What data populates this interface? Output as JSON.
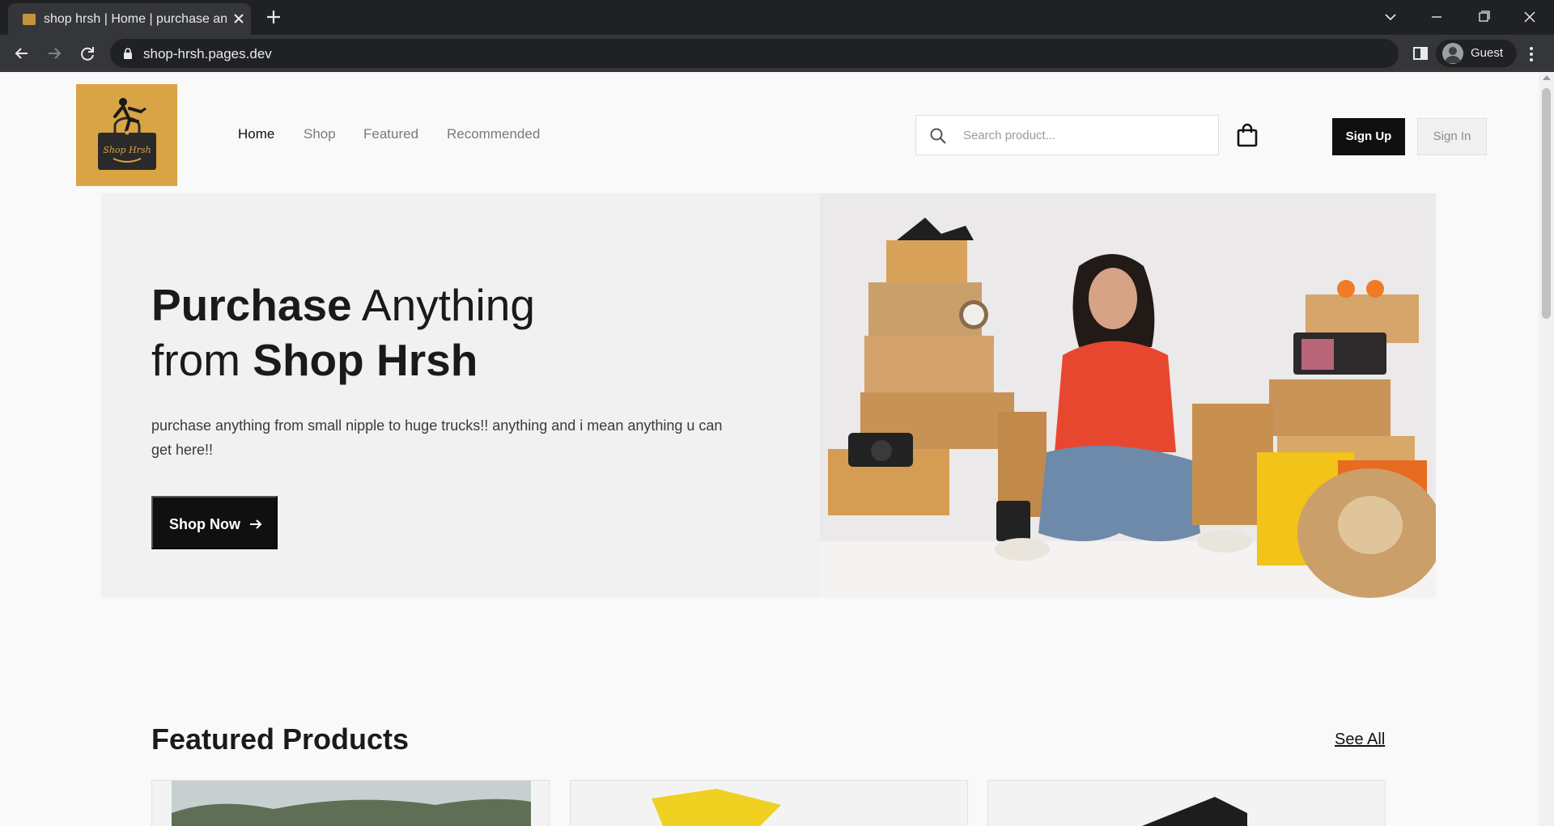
{
  "browser": {
    "tab_title": "shop hrsh | Home | purchase anything",
    "url": "shop-hrsh.pages.dev",
    "profile_name": "Guest"
  },
  "header": {
    "logo_text": "Shop Hrsh",
    "nav": [
      {
        "label": "Home",
        "active": true
      },
      {
        "label": "Shop",
        "active": false
      },
      {
        "label": "Featured",
        "active": false
      },
      {
        "label": "Recommended",
        "active": false
      }
    ],
    "search_placeholder": "Search product...",
    "signup_label": "Sign Up",
    "signin_label": "Sign In"
  },
  "hero": {
    "title_bold_1": "Purchase",
    "title_regular_1": " Anything",
    "title_regular_2": "from ",
    "title_bold_2": "Shop Hrsh",
    "description": "purchase anything from small nipple to huge trucks!! anything and i mean anything u can get here!!",
    "cta_label": "Shop Now"
  },
  "featured": {
    "title": "Featured Products",
    "see_all_label": "See All"
  },
  "colors": {
    "brand_logo_bg": "#d9a445",
    "primary_button": "#101010",
    "page_bg": "#f9f9f9"
  }
}
